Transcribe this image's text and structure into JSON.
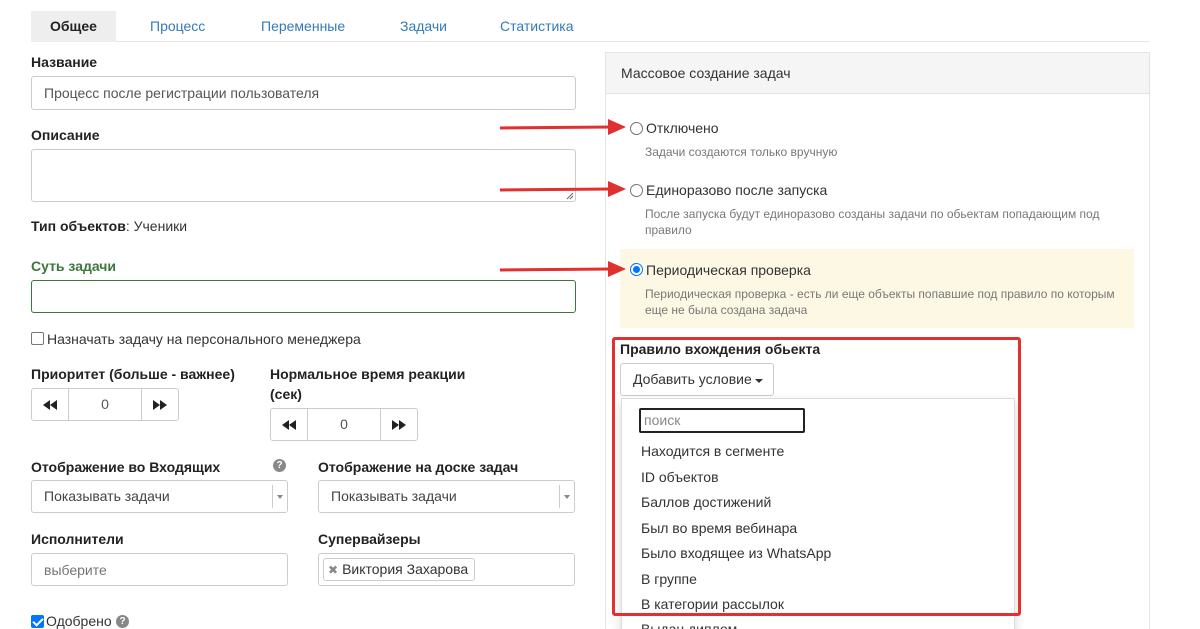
{
  "tabs": [
    {
      "label": "Общее",
      "active": true
    },
    {
      "label": "Процесс"
    },
    {
      "label": "Переменные"
    },
    {
      "label": "Задачи"
    },
    {
      "label": "Статистика"
    }
  ],
  "form": {
    "name_label": "Название",
    "name_value": "Процесс после регистрации пользователя",
    "description_label": "Описание",
    "description_value": "",
    "object_type_label": "Тип объектов",
    "object_type_value": ": Ученики",
    "task_essence_label": "Суть задачи",
    "task_essence_value": "",
    "assign_manager_label": "Назначать задачу на персонального менеджера",
    "assign_manager_checked": false,
    "priority_label": "Приоритет (больше - важнее)",
    "priority_value": "0",
    "reaction_label_1": "Нормальное время реакции",
    "reaction_label_2": "(сек)",
    "reaction_value": "0",
    "inbox_display_label": "Отображение во Входящих",
    "inbox_display_value": "Показывать задачи",
    "board_display_label": "Отображение на доске задач",
    "board_display_value": "Показывать задачи",
    "executors_label": "Исполнители",
    "executors_placeholder": "выберите",
    "supervisors_label": "Супервайзеры",
    "supervisors_tag": "Виктория Захарова",
    "approved_label": "Одобрено",
    "approved_checked": true
  },
  "panel": {
    "title": "Массовое создание задач",
    "options": [
      {
        "label": "Отключено",
        "help": "Задачи создаются только вручную",
        "checked": false
      },
      {
        "label": "Единоразово после запуска",
        "help_1": "После запуска будут единоразово созданы задачи по обьектам попадающим под",
        "help_2": "правило",
        "checked": false
      },
      {
        "label": "Периодическая проверка",
        "help_1": "Периодическая проверка - есть ли еще объекты попавшие под правило по которым",
        "help_2": "еще не была создана задача",
        "checked": true
      }
    ],
    "rule_label": "Правило вхождения обьекта",
    "add_condition_label": "Добавить условие",
    "search_placeholder": "поиск",
    "conditions": [
      "Находится в сегменте",
      "ID объектов",
      "Баллов достижений",
      "Был во время вебинара",
      "Было входящее из WhatsApp",
      "В группе",
      "В категории рассылок",
      "Выдан диплом"
    ]
  },
  "colors": {
    "link": "#337ab7",
    "highlight": "#fcf8e3",
    "annotation_red": "#e03030",
    "radio_blue": "#0075ff"
  },
  "icons": {
    "prev": "double-left-arrow-icon",
    "next": "double-right-arrow-icon",
    "help": "question-circle-icon"
  }
}
